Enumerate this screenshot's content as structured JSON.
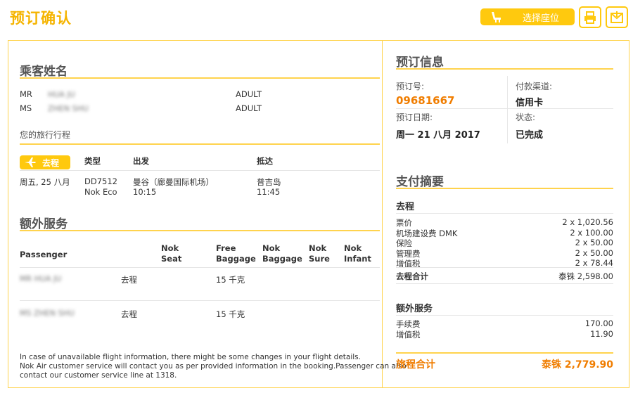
{
  "header": {
    "title": "预订确认",
    "select_seat_label": "选择座位",
    "print_icon": "printer-icon",
    "email_icon": "mail-icon"
  },
  "passengers_section": {
    "title": "乘客姓名",
    "passengers": [
      {
        "title": "MR",
        "name": "HUA JU",
        "type": "ADULT"
      },
      {
        "title": "MS",
        "name": "ZHEN SHU",
        "type": "ADULT"
      }
    ]
  },
  "itinerary": {
    "title": "您的旅行行程",
    "direction_label": "去程",
    "headers": {
      "type": "类型",
      "depart": "出发",
      "arrive": "抵达"
    },
    "date": "周五, 25 八月",
    "flight_no": "DD7512",
    "fare_class": "Nok Eco",
    "depart_place": "曼谷（廊曼国际机场）",
    "depart_time": "10:15",
    "arrive_place": "普吉岛",
    "arrive_time": "11:45"
  },
  "extras": {
    "title": "额外服务",
    "headers": {
      "passenger": "Passenger",
      "nok_seat": [
        "Nok",
        "Seat"
      ],
      "free_baggage": [
        "Free",
        "Baggage"
      ],
      "nok_baggage": [
        "Nok",
        "Baggage"
      ],
      "nok_sure": [
        "Nok",
        "Sure"
      ],
      "nok_infant": [
        "Nok",
        "Infant"
      ]
    },
    "rows": [
      {
        "name": "MR HUA JU",
        "direction": "去程",
        "free_baggage": "15 千克"
      },
      {
        "name": "MS ZHEN SHU",
        "direction": "去程",
        "free_baggage": "15 千克"
      }
    ]
  },
  "footer_note": {
    "line1": "In case of unavailable flight information, there might be some changes in your flight details.",
    "line2": "Nok Air customer service will contact you as per provided information in the booking.Passenger can also",
    "line3": "contact our customer service line at 1318."
  },
  "booking_info": {
    "title": "预订信息",
    "booking_no_label": "预订号:",
    "booking_no": "09681667",
    "channel_label": "付款渠道:",
    "channel": "信用卡",
    "date_label": "预订日期:",
    "date": "周一 21 八月 2017",
    "status_label": "状态:",
    "status": "已完成"
  },
  "payment": {
    "title": "支付摘要",
    "outbound_title": "去程",
    "items": [
      {
        "label": "票价",
        "value": "2 x 1,020.56"
      },
      {
        "label": "机场建设费 DMK",
        "value": "2 x 100.00"
      },
      {
        "label": "保险",
        "value": "2 x 50.00"
      },
      {
        "label": "管理费",
        "value": "2 x 50.00"
      },
      {
        "label": "增值税",
        "value": "2 x 78.44"
      }
    ],
    "outbound_total_label": "去程合计",
    "outbound_total_value": "泰铢  2,598.00",
    "extras_title": "额外服务",
    "extra_items": [
      {
        "label": "手续费",
        "value": "170.00"
      },
      {
        "label": "增值税",
        "value": "11.90"
      }
    ],
    "grand_total_label": "旅程合计",
    "grand_total_value": "泰铢 2,779.90"
  },
  "colors": {
    "accent": "#ffc90e",
    "title_yellow": "#f5b400",
    "border": "#ffd34d",
    "orange": "#f07d00"
  }
}
